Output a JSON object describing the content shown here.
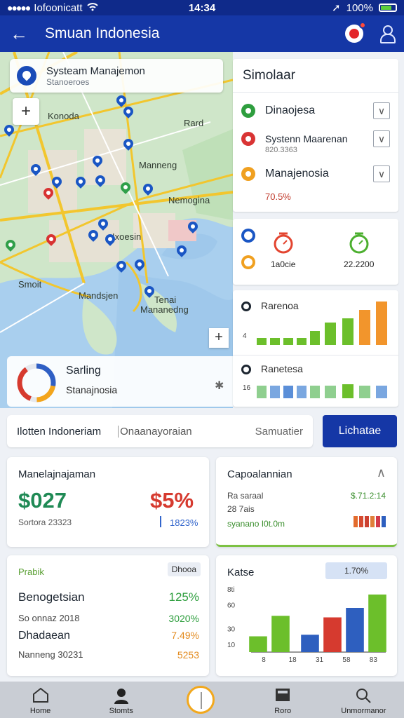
{
  "status_bar": {
    "carrier": "Iofoonicatt",
    "time": "14:34",
    "battery": "100%"
  },
  "app_bar": {
    "title": "Smuan Indonesia"
  },
  "map": {
    "info_card": {
      "title": "Systeam Manajemon",
      "subtitle": "Stanoeroes"
    },
    "zoom_in": "+",
    "labels": {
      "kanoda": "Konoda",
      "rard": "Rard",
      "manneng": "Manneng",
      "nemogina": "Nemogina",
      "ixoesin": "Ixoesin",
      "smoit": "Smoit",
      "mandjsjen": "Mandsjen",
      "tenai": "Tenai",
      "manangding": "Mananedng"
    },
    "donut_card": {
      "title": "Sarling",
      "subtitle": "Stanajnosia",
      "progress": 0.62
    }
  },
  "simulasi": {
    "title": "Simolaar",
    "rows": [
      {
        "label": "Dinaojesa",
        "sub": "",
        "color": "#2e9e3e"
      },
      {
        "label": "Systenn Maarenan",
        "sub": "820.3363",
        "color": "#d93434"
      },
      {
        "label": "Manajenosia",
        "sub": "",
        "color": "#f0a020"
      }
    ],
    "percent": "70.5%"
  },
  "gauges": {
    "left_label": "1a0cie",
    "right_label": "22.2200",
    "left_color": "#e3442f",
    "right_color": "#4caf2f"
  },
  "bar_panel": {
    "top": {
      "title": "Rarenoa",
      "y_label": "4"
    },
    "bottom": {
      "title": "Ranetesa",
      "y_label": "16"
    }
  },
  "search": {
    "label": "Ilotten Indoneriam",
    "value": "Onaanayoraian",
    "placeholder": "Samuatier",
    "button": "Lichatae"
  },
  "card_stats": {
    "title": "Manelajnajaman",
    "value_left": "$027",
    "value_right": "$5%",
    "sub_left": "Sortora 23323",
    "sub_right": "1823%"
  },
  "card_deposit": {
    "title": "Capoalannian",
    "line1": "Ra saraal",
    "line2": "28 7ais",
    "line3": "syanano I0t.0m",
    "right_value": "$.71.2:14",
    "mini_bar_colors": [
      "#e36b2c",
      "#d64a30",
      "#cc4030",
      "#e07f3a",
      "#d33a4a",
      "#2e5fbf"
    ]
  },
  "card_list": {
    "tag": "Prabik",
    "badge": "Dhooa",
    "rows": [
      {
        "label": "Benogetsian",
        "value": "125%",
        "color": "#2e9e3e",
        "icon": "#8a2a7a"
      },
      {
        "label": "So onnaz 2018",
        "value": "3020%",
        "color": "#2e9e3e",
        "icon": "#3f9e2f"
      },
      {
        "label": "Dhadaean",
        "value": "7.49%",
        "color": "#e38b1f",
        "icon": "#e38b1f"
      },
      {
        "label": "Nanneng 30231",
        "value": "5253",
        "color": "#e38b1f",
        "icon": "#2e5fbf"
      }
    ]
  },
  "card_chart": {
    "title": "Katse",
    "badge": "1.70%",
    "chart_data": {
      "type": "bar",
      "categories": [
        "8",
        "18",
        "31",
        "58",
        "83"
      ],
      "values": [
        20,
        46,
        22,
        44,
        56,
        73
      ],
      "colors": [
        "#6cbf2b",
        "#6cbf2b",
        "#2e5fbf",
        "#d63a2f",
        "#2e5fbf",
        "#6cbf2b"
      ],
      "y_ticks": [
        "8ti",
        "60",
        "30",
        "10"
      ],
      "ylim": [
        0,
        80
      ]
    }
  },
  "bottom_nav": {
    "items": [
      {
        "label": "Home"
      },
      {
        "label": "Stomts"
      },
      {
        "label": ""
      },
      {
        "label": "Roro"
      },
      {
        "label": "Unmormanor"
      }
    ]
  }
}
